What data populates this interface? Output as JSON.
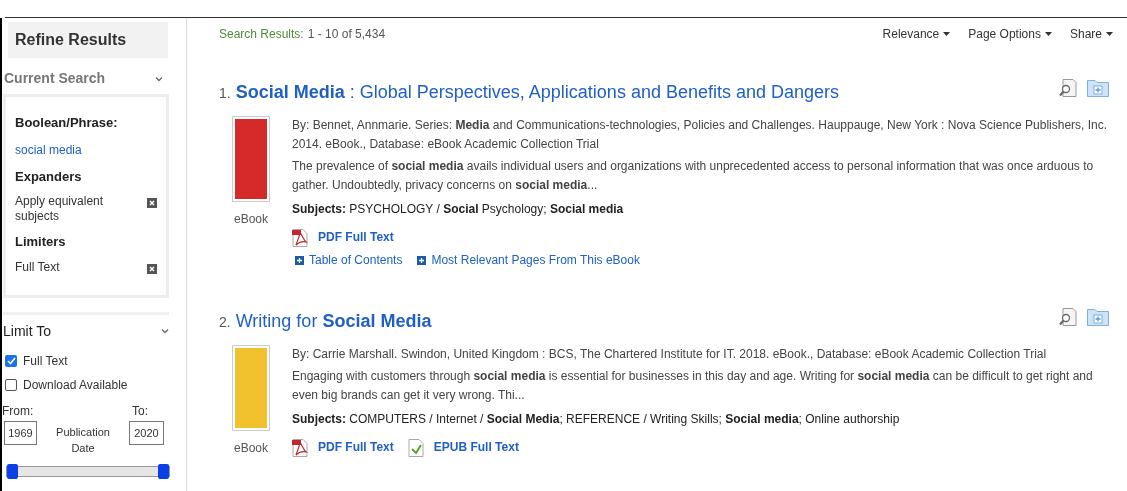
{
  "sidebar": {
    "title": "Refine Results",
    "current_search": {
      "heading": "Current Search",
      "expanded": true,
      "groups": [
        {
          "heading": "Boolean/Phrase:",
          "items": [
            {
              "kind": "link",
              "label": "social media"
            }
          ]
        },
        {
          "heading": "Expanders",
          "items": [
            {
              "kind": "removable",
              "label": "Apply equivalent subjects"
            }
          ]
        },
        {
          "heading": "Limiters",
          "items": [
            {
              "kind": "removable",
              "label": "Full Text"
            }
          ]
        }
      ]
    },
    "limit_to": {
      "heading": "Limit To",
      "expanded": true,
      "options": [
        {
          "label": "Full Text",
          "checked": true
        },
        {
          "label": "Download Available",
          "checked": false
        }
      ],
      "from_label": "From:",
      "from_value": "1969",
      "to_label": "To:",
      "to_value": "2020",
      "date_label": "Publication Date",
      "thumbs": [
        {
          "level": 0
        },
        {
          "level": 1
        }
      ]
    }
  },
  "results_header": {
    "label": "Search Results:",
    "range": "1 - 10 of 5,434",
    "menus": [
      "Relevance",
      "Page Options",
      "Share"
    ]
  },
  "results": [
    {
      "number": "1.",
      "title": "**Social Media** : Global Perspectives, Applications and Benefits and Dangers",
      "cover": {
        "color": "#d42a2a"
      },
      "type": "eBook",
      "meta": "By: Bennet, Annmarie. Series: **Media** and Communications-technologies, Policies and Challenges. Hauppauge, New York : Nova Science Publishers, Inc. 2014. eBook., Database: eBook Academic Collection Trial",
      "abstract": "The prevalence of **social media** avails individual users and organizations with unprecedented access to personal information that was once arduous to gather. Undoubtedly, privacy concerns on **social media**...",
      "subjects": "**Subjects:** PSYCHOLOGY / **Social** Psychology; **Social media**",
      "links": [
        {
          "kind": "pdf",
          "label": "PDF Full Text"
        }
      ],
      "extra_links": [
        "Table of Contents",
        "Most Relevant Pages From This eBook"
      ]
    },
    {
      "number": "2.",
      "title": "Writing for **Social Media**",
      "cover": {
        "color": "#f2c12e"
      },
      "type": "eBook",
      "meta": "By: Carrie Marshall. Swindon, United Kingdom : BCS, The Chartered Institute for IT. 2018. eBook., Database: eBook Academic Collection Trial",
      "abstract": "Engaging with customers through **social media** is essential for businesses in this day and age. Writing for **social media** can be difficult to get right and even big brands can get it very wrong. Thi...",
      "subjects": "**Subjects:** COMPUTERS / Internet / **Social Media**; REFERENCE / Writing Skills; **Social media**; Online authorship",
      "links": [
        {
          "kind": "pdf",
          "label": "PDF Full Text"
        },
        {
          "kind": "epub",
          "label": "EPUB Full Text"
        }
      ]
    }
  ]
}
